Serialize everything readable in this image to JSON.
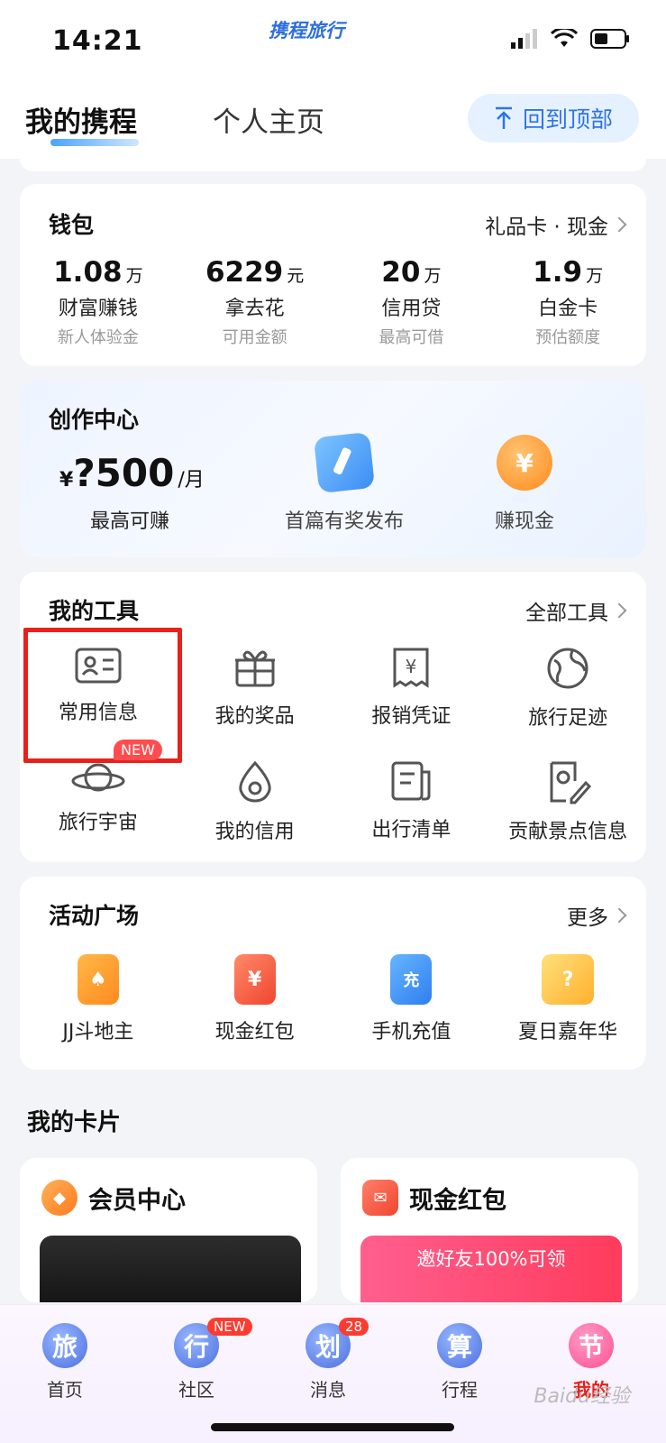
{
  "status": {
    "time": "14:21",
    "brand": "携程旅行"
  },
  "header": {
    "tab_active": "我的携程",
    "tab_inactive": "个人主页",
    "back_to_top": "回到顶部"
  },
  "wallet": {
    "title": "钱包",
    "link": "礼品卡 · 现金",
    "items": [
      {
        "value": "1.08",
        "unit": "万",
        "label": "财富赚钱",
        "sub": "新人体验金"
      },
      {
        "value": "6229",
        "unit": "元",
        "label": "拿去花",
        "sub": "可用金额"
      },
      {
        "value": "20",
        "unit": "万",
        "label": "信用贷",
        "sub": "最高可借"
      },
      {
        "value": "1.9",
        "unit": "万",
        "label": "白金卡",
        "sub": "预估额度"
      }
    ]
  },
  "creator": {
    "title": "创作中心",
    "currency": "¥",
    "amount": "?500",
    "per": "/月",
    "sub": "最高可赚",
    "actions": [
      "首篇有奖发布",
      "赚现金"
    ]
  },
  "tools": {
    "title": "我的工具",
    "link": "全部工具",
    "items": [
      "常用信息",
      "我的奖品",
      "报销凭证",
      "旅行足迹",
      "旅行宇宙",
      "我的信用",
      "出行清单",
      "贡献景点信息"
    ],
    "new_badge": "NEW"
  },
  "activity": {
    "title": "活动广场",
    "link": "更多",
    "items": [
      "JJ斗地主",
      "现金红包",
      "手机充值",
      "夏日嘉年华"
    ],
    "icon_glyphs": [
      "♠",
      "¥",
      "充",
      "?"
    ]
  },
  "cards": {
    "title": "我的卡片",
    "card1": "会员中心",
    "card2": "现金红包",
    "card2_banner": "邀好友100%可领"
  },
  "tabbar": {
    "items": [
      {
        "glyph": "旅",
        "label": "首页"
      },
      {
        "glyph": "行",
        "label": "社区",
        "badge": "NEW"
      },
      {
        "glyph": "划",
        "label": "消息",
        "badge": "28"
      },
      {
        "glyph": "算",
        "label": "行程"
      },
      {
        "glyph": "节",
        "label": "我的"
      }
    ]
  },
  "watermark": "Baidu经验",
  "colors": {
    "accent": "#2d74e6",
    "highlight": "#e8211b",
    "badge": "#ff4d4f"
  }
}
